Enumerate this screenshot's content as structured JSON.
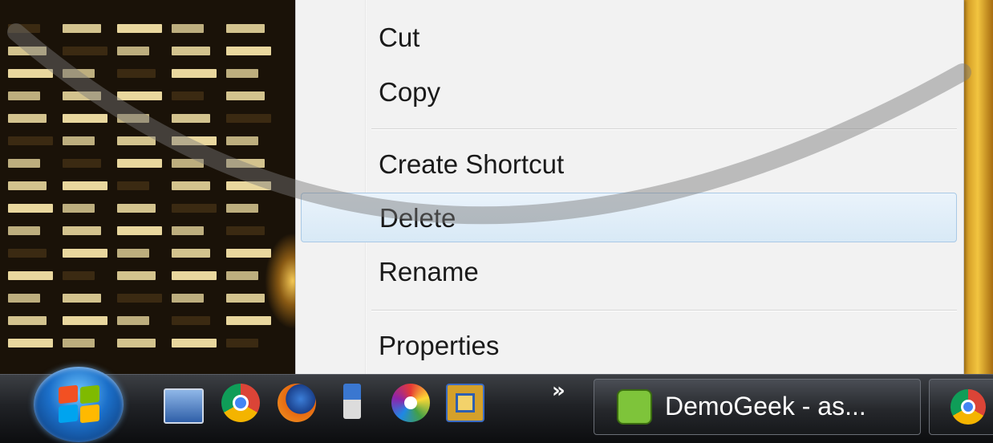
{
  "context_menu": {
    "items": [
      {
        "label": "Cut",
        "highlighted": false
      },
      {
        "label": "Copy",
        "highlighted": false
      },
      {
        "label": "Create Shortcut",
        "highlighted": false
      },
      {
        "label": "Delete",
        "highlighted": true
      },
      {
        "label": "Rename",
        "highlighted": false
      },
      {
        "label": "Properties",
        "highlighted": false
      }
    ]
  },
  "taskbar": {
    "start_button_icon": "windows-logo-icon",
    "quick_launch": [
      {
        "icon": "show-desktop-icon"
      },
      {
        "icon": "chrome-icon"
      },
      {
        "icon": "firefox-icon"
      },
      {
        "icon": "usb-drive-icon"
      },
      {
        "icon": "color-wheel-icon"
      },
      {
        "icon": "window-switcher-icon"
      }
    ],
    "overflow_label": "»",
    "active_task": {
      "label": "DemoGeek - as...",
      "icon": "evernote-icon"
    },
    "second_task": {
      "icon": "chrome-icon"
    }
  },
  "colors": {
    "menu_background": "#f2f2f2",
    "menu_highlight": "#d8e9f6",
    "taskbar": "#202226"
  }
}
